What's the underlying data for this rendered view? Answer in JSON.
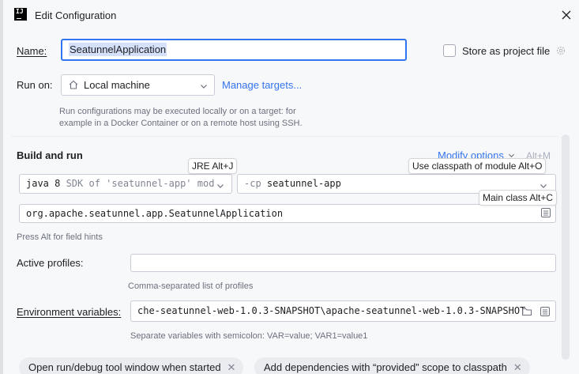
{
  "window": {
    "title": "Edit Configuration",
    "logo_text": "IJ"
  },
  "name": {
    "label": "Name:",
    "value": "SeatunnelApplication"
  },
  "store_as_project_file": {
    "label": "Store as project file",
    "checked": false
  },
  "run_on": {
    "label": "Run on:",
    "target": "Local machine",
    "manage_link": "Manage targets...",
    "hint_line1": "Run configurations may be executed locally or on a target: for",
    "hint_line2": "example in a Docker Container or on a remote host using SSH."
  },
  "build_and_run": {
    "title": "Build and run",
    "modify_options": "Modify options",
    "modify_shortcut": "Alt+M",
    "jre_tooltip": "JRE Alt+J",
    "jre_value_bold": "java 8",
    "jre_value_rest": " SDK of 'seatunnel-app' mod",
    "cp_tooltip": "Use classpath of module Alt+O",
    "cp_prefix": "-cp",
    "cp_value": "seatunnel-app",
    "main_class_tooltip": "Main class Alt+C",
    "main_class_value": "org.apache.seatunnel.app.SeatunnelApplication",
    "field_hint": "Press Alt for field hints"
  },
  "active_profiles": {
    "label": "Active profiles:",
    "value": "",
    "hint": "Comma-separated list of profiles"
  },
  "env_vars": {
    "label": "Environment variables:",
    "value": "che-seatunnel-web-1.0.3-SNAPSHOT\\apache-seatunnel-web-1.0.3-SNAPSHOT",
    "hint": "Separate variables with semicolon: VAR=value; VAR1=value1"
  },
  "chips": [
    {
      "label": "Open run/debug tool window when started"
    },
    {
      "label": "Add dependencies with “provided” scope to classpath"
    }
  ],
  "colors": {
    "accent": "#3574f0",
    "background": "#f7f8fa",
    "selection": "#d5e1fb"
  }
}
